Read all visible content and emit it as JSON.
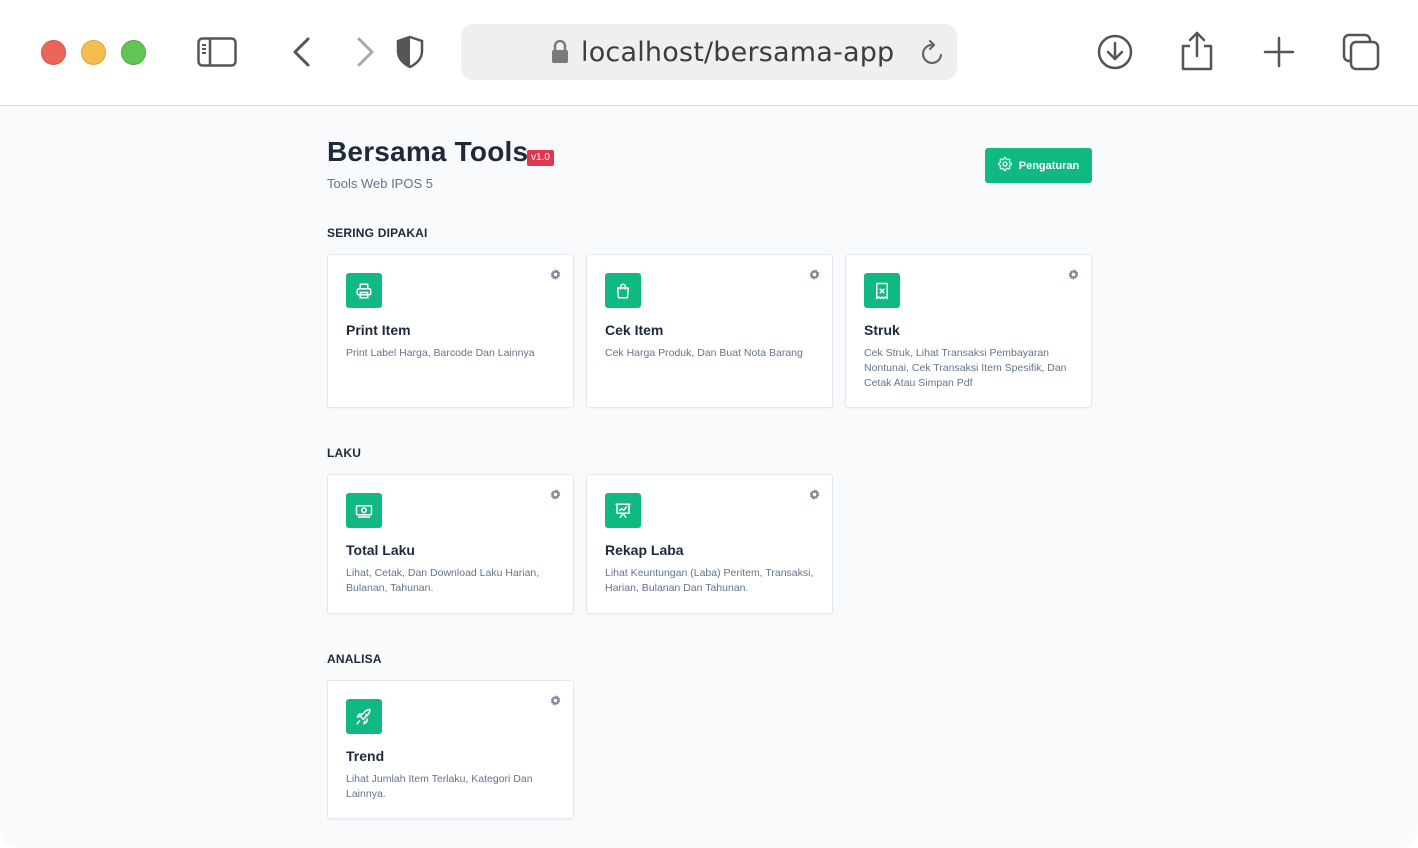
{
  "browser": {
    "url": "localhost/bersama-app"
  },
  "header": {
    "title": "Bersama Tools",
    "version": "v1.0",
    "subtitle": "Tools Web IPOS 5",
    "settings_label": "Pengaturan"
  },
  "sections": [
    {
      "label": "SERING DIPAKAI",
      "cards": [
        {
          "title": "Print Item",
          "description": "Print Label Harga, Barcode Dan Lainnya",
          "icon": "printer-icon"
        },
        {
          "title": "Cek Item",
          "description": "Cek Harga Produk, Dan Buat Nota Barang",
          "icon": "shopping-bag-icon"
        },
        {
          "title": "Struk",
          "description": "Cek Struk, Lihat Transaksi Pembayaran Nontunai, Cek Transaksi Item Spesifik, Dan Cetak Atau Simpan Pdf",
          "icon": "receipt-icon"
        }
      ]
    },
    {
      "label": "LAKU",
      "cards": [
        {
          "title": "Total Laku",
          "description": "Lihat, Cetak, Dan Download Laku Harian, Bulanan, Tahunan.",
          "icon": "cash-icon"
        },
        {
          "title": "Rekap Laba",
          "description": "Lihat Keuntungan (Laba) Peritem, Transaksi, Harian, Bulanan Dan Tahunan.",
          "icon": "presentation-chart-icon"
        }
      ]
    },
    {
      "label": "ANALISA",
      "cards": [
        {
          "title": "Trend",
          "description": "Lihat Jumlah Item Terlaku, Kategori Dan Lainnya.",
          "icon": "rocket-icon"
        }
      ]
    }
  ],
  "colors": {
    "accent": "#10b981",
    "badge": "#e0364f",
    "background": "#f8fafc"
  }
}
